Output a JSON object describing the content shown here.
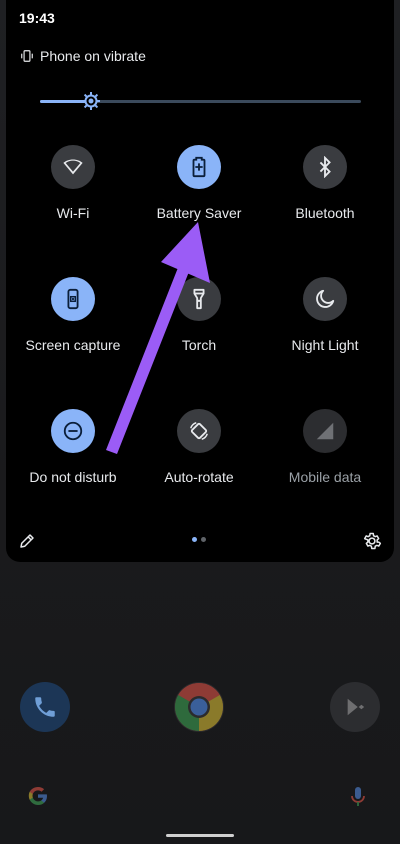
{
  "status_bar": {
    "time": "19:43"
  },
  "header": {
    "ringer_status": "Phone on vibrate"
  },
  "brightness": {
    "level": 0.16
  },
  "tiles": [
    {
      "label": "Wi-Fi",
      "icon": "wifi-icon",
      "state": "off"
    },
    {
      "label": "Battery Saver",
      "icon": "battery-saver-icon",
      "state": "on"
    },
    {
      "label": "Bluetooth",
      "icon": "bluetooth-icon",
      "state": "off"
    },
    {
      "label": "Screen capture",
      "icon": "screen-capture-icon",
      "state": "on"
    },
    {
      "label": "Torch",
      "icon": "torch-icon",
      "state": "off"
    },
    {
      "label": "Night Light",
      "icon": "night-light-icon",
      "state": "off"
    },
    {
      "label": "Do not disturb",
      "icon": "do-not-disturb-icon",
      "state": "on"
    },
    {
      "label": "Auto-rotate",
      "icon": "auto-rotate-icon",
      "state": "off"
    },
    {
      "label": "Mobile data",
      "icon": "mobile-data-icon",
      "state": "unavailable"
    }
  ],
  "pager": {
    "pages": 2,
    "current": 1
  },
  "footer": {
    "edit_icon": "pencil-icon",
    "settings_icon": "gear-icon"
  },
  "dock": {
    "apps": [
      {
        "name": "Phone",
        "icon": "phone-icon"
      },
      {
        "name": "Chrome",
        "icon": "chrome-icon"
      },
      {
        "name": "Play Store",
        "icon": "play-store-icon"
      }
    ],
    "search_icon": "google-g-icon",
    "mic_icon": "mic-icon"
  },
  "annotation": {
    "type": "arrow",
    "color": "#9b5cf6",
    "points_to": "Battery Saver"
  },
  "colors": {
    "accent": "#8ab4f8",
    "tile_off": "#3a3c40",
    "shade": "#000000",
    "annotation": "#9b5cf6"
  }
}
